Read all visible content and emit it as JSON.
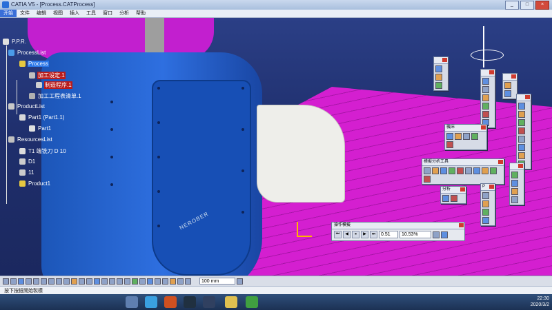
{
  "window": {
    "title": "CATIA V5 - [Process.CATProcess]",
    "buttons": [
      "_",
      "□",
      "×"
    ]
  },
  "menubar": [
    "开始",
    "文件",
    "编辑",
    "视图",
    "插入",
    "工具",
    "窗口",
    "分析",
    "帮助"
  ],
  "tree": {
    "root": "P.P.R.",
    "process_list": "ProcessList",
    "process": "Process",
    "machining_setup": "加工设定.1",
    "manufacturing_program": "制造程序.1",
    "machining_list": "加工工程表清单.1",
    "product_list": "ProductList",
    "part_instance": "Part1 (Part1.1)",
    "part": "Part1",
    "resources_list": "ResourcesList",
    "tool": "T1 端铣刀 D 10",
    "d1": "D1",
    "eleven": "11",
    "product": "Product1"
  },
  "viewport": {
    "machine_brand": "NEROBER"
  },
  "toolbars": {
    "machine": "機床",
    "analysis_tools": "模擬分析工具",
    "analysis": "分析",
    "p": "P"
  },
  "simulation": {
    "title": "操作模擬",
    "buttons": [
      "⏮",
      "◀",
      "⏸",
      "▶",
      "⏭"
    ],
    "step": "0.51",
    "percent": "10.53%"
  },
  "bottom_toolbar": {
    "unit": "100 mm"
  },
  "status": {
    "text": "按下按鈕開始製模"
  },
  "taskbar": {
    "time": "22:30",
    "date": "2020/3/2"
  }
}
